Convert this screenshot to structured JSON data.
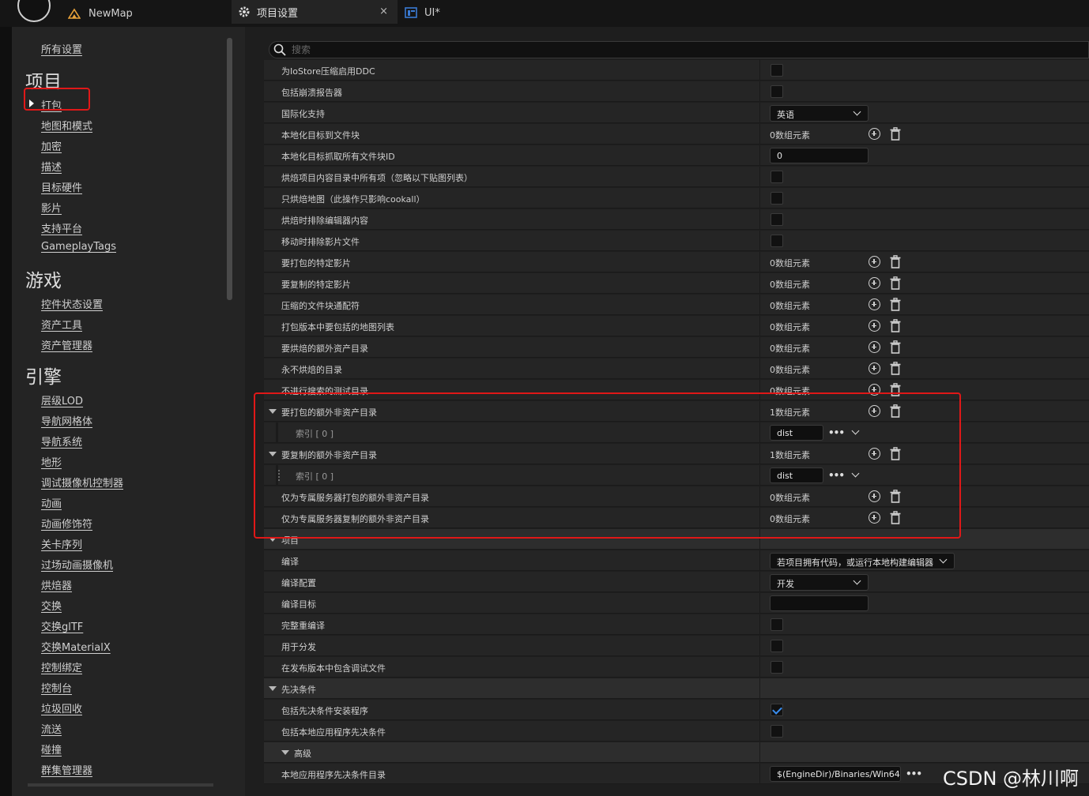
{
  "titlebar": {
    "tabs": [
      {
        "label": "NewMap",
        "icon": "map-icon"
      },
      {
        "label": "项目设置",
        "icon": "gear-icon",
        "close": "×"
      },
      {
        "label": "UI*",
        "icon": "widget-icon"
      }
    ]
  },
  "sidebar": {
    "all_settings": "所有设置",
    "sections": [
      {
        "title": "项目",
        "items": [
          "打包",
          "地图和模式",
          "加密",
          "描述",
          "目标硬件",
          "影片",
          "支持平台",
          "GameplayTags"
        ]
      },
      {
        "title": "游戏",
        "items": [
          "控件状态设置",
          "资产工具",
          "资产管理器"
        ]
      },
      {
        "title": "引擎",
        "items": [
          "层级LOD",
          "导航网格体",
          "导航系统",
          "地形",
          "调试摄像机控制器",
          "动画",
          "动画修饰符",
          "关卡序列",
          "过场动画摄像机",
          "烘焙器",
          "交换",
          "交换glTF",
          "交换MaterialX",
          "控制绑定",
          "控制台",
          "垃圾回收",
          "流送",
          "碰撞",
          "群集管理器"
        ]
      }
    ]
  },
  "search": {
    "placeholder": "搜索"
  },
  "rows": [
    {
      "name": "为IoStore压缩启用DDC",
      "kind": "checkbox",
      "checked": false
    },
    {
      "name": "包括崩溃报告器",
      "kind": "checkbox",
      "checked": false
    },
    {
      "name": "国际化支持",
      "kind": "combo",
      "value": "英语"
    },
    {
      "name": "本地化目标到文件块",
      "kind": "array",
      "value": "0数组元素"
    },
    {
      "name": "本地化目标抓取所有文件块ID",
      "kind": "text",
      "value": "0"
    },
    {
      "name": "烘焙项目内容目录中所有项（忽略以下贴图列表）",
      "kind": "checkbox",
      "checked": false
    },
    {
      "name": "只烘焙地图（此操作只影响cookall）",
      "kind": "checkbox",
      "checked": false
    },
    {
      "name": "烘焙时排除编辑器内容",
      "kind": "checkbox",
      "checked": false
    },
    {
      "name": "移动时排除影片文件",
      "kind": "checkbox",
      "checked": false
    },
    {
      "name": "要打包的特定影片",
      "kind": "array",
      "value": "0数组元素"
    },
    {
      "name": "要复制的特定影片",
      "kind": "array",
      "value": "0数组元素"
    },
    {
      "name": "压缩的文件块通配符",
      "kind": "array",
      "value": "0数组元素"
    },
    {
      "name": "打包版本中要包括的地图列表",
      "kind": "array",
      "value": "0数组元素"
    },
    {
      "name": "要烘焙的额外资产目录",
      "kind": "array",
      "value": "0数组元素"
    },
    {
      "name": "永不烘焙的目录",
      "kind": "array",
      "value": "0数组元素"
    },
    {
      "name": "不进行搜索的测试目录",
      "kind": "array",
      "value": "0数组元素"
    },
    {
      "name": "要打包的额外非资产目录",
      "kind": "array",
      "value": "1数组元素",
      "expanded": true
    },
    {
      "name": "索引 [ 0 ]",
      "kind": "element",
      "value": "dist"
    },
    {
      "name": "要复制的额外非资产目录",
      "kind": "array",
      "value": "1数组元素",
      "expanded": true
    },
    {
      "name": "索引 [ 0 ]",
      "kind": "element",
      "value": "dist",
      "grip": true
    },
    {
      "name": "仅为专属服务器打包的额外非资产目录",
      "kind": "array",
      "value": "0数组元素"
    },
    {
      "name": "仅为专属服务器复制的额外非资产目录",
      "kind": "array",
      "value": "0数组元素"
    },
    {
      "name": "项目",
      "kind": "category"
    },
    {
      "name": "编译",
      "kind": "combo",
      "value": "若项目拥有代码，或运行本地构建编辑器",
      "wide": true
    },
    {
      "name": "编译配置",
      "kind": "combo",
      "value": "开发"
    },
    {
      "name": "编译目标",
      "kind": "text",
      "value": ""
    },
    {
      "name": "完整重编译",
      "kind": "checkbox",
      "checked": false
    },
    {
      "name": "用于分发",
      "kind": "checkbox",
      "checked": false
    },
    {
      "name": "在发布版本中包含调试文件",
      "kind": "checkbox",
      "checked": false
    },
    {
      "name": "先决条件",
      "kind": "category"
    },
    {
      "name": "包括先决条件安装程序",
      "kind": "checkbox",
      "checked": true
    },
    {
      "name": "包括本地应用程序先决条件",
      "kind": "checkbox",
      "checked": false
    },
    {
      "name": "高级",
      "kind": "subcategory"
    },
    {
      "name": "本地应用程序先决条件目录",
      "kind": "path",
      "value": "$(EngineDir)/Binaries/Win64"
    }
  ],
  "watermark": "CSDN @林川啊",
  "colors": {
    "highlight_box": "#e01818",
    "check": "#3a8ef0",
    "mapicon": "#e8a23a",
    "uiicon": "#3a7bd5"
  }
}
